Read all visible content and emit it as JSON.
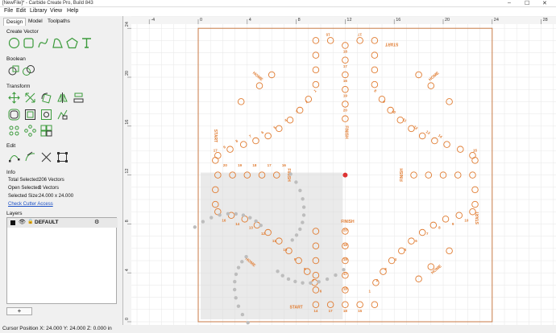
{
  "window": {
    "title": "[NewFile]* - Carbide Create Pro, Build 843",
    "controls": [
      "–",
      "☐",
      "✕"
    ]
  },
  "menu": [
    "File",
    "Edit",
    "Library",
    "View",
    "Help"
  ],
  "tabs": [
    "Design",
    "Model",
    "Toolpaths"
  ],
  "sections": {
    "create_vector": "Create Vector",
    "boolean": "Boolean",
    "transform": "Transform",
    "edit": "Edit",
    "info": "Info",
    "layers": "Layers"
  },
  "icons": {
    "create_vector": [
      "circle-icon",
      "rectangle-icon",
      "curve-icon",
      "polygon-icon",
      "pentagon-icon",
      "text-icon"
    ],
    "boolean": [
      "boolean-union-icon",
      "boolean-subtract-icon"
    ],
    "transform_row1": [
      "move-icon",
      "scale-icon",
      "rotate-icon",
      "mirror-icon",
      "align-icon"
    ],
    "transform_row2": [
      "offset-icon",
      "inset-icon",
      "outline-icon",
      "shape-icon"
    ],
    "transform_row3": [
      "array-icon",
      "circular-array-icon",
      "grid-array-icon"
    ],
    "edit": [
      "node-edit-icon",
      "bezier-icon",
      "cut-icon",
      "bounding-box-icon"
    ]
  },
  "info": {
    "total_selected": "Total Selected:",
    "total_selected_value": "206 Vectors",
    "open_selected": "Open Selected:",
    "open_selected_value": "0 Vectors",
    "selected_size": "Selected Size:",
    "selected_size_value": "24.000 x 24.000",
    "check_link": "Check Cutter Access"
  },
  "layers": {
    "name": "DEFAULT",
    "add_label": "+"
  },
  "status": "Cursor Position X: 24.000 Y: 24.000 Z: 0.000 in",
  "rulers": {
    "top": [
      "-4",
      "0",
      "4",
      "8",
      "12",
      "16",
      "20",
      "24",
      "28"
    ],
    "left": [
      "24",
      "20",
      "16",
      "12",
      "8",
      "4",
      "0"
    ]
  },
  "board": {
    "labels": {
      "start": "START",
      "home": "HOME",
      "finish": "FINISH"
    },
    "numbers": {
      "up_arm_left": [
        "15",
        "14",
        "13",
        "12",
        "11",
        "10",
        "9",
        "8",
        "7",
        "6",
        "5",
        "4",
        "3",
        "2"
      ],
      "up_arm_middle": [
        "18",
        "17",
        "16",
        "19",
        "20"
      ],
      "up_arm_right": [
        "17",
        "15",
        "14",
        "1",
        "2",
        "3",
        "4",
        "5",
        "6",
        "7",
        "8",
        "9",
        "10",
        "11",
        "12",
        "13",
        "14"
      ],
      "left_arm": [
        "1",
        "2",
        "3",
        "4",
        "5",
        "6",
        "7",
        "8",
        "9"
      ],
      "left_col": [
        "14",
        "15",
        "17",
        "18",
        "19",
        "20",
        "18",
        "15",
        "16"
      ],
      "right_arm": [
        "8",
        "9",
        "10",
        "11",
        "12",
        "13",
        "14"
      ],
      "right_col": [
        "15",
        "16",
        "17",
        "18",
        "19",
        "20"
      ],
      "bottom_left": [
        "16",
        "14",
        "13",
        "12",
        "11",
        "10",
        "9",
        "8",
        "7",
        "6"
      ],
      "bottom_mid": [
        "5",
        "4",
        "3",
        "2",
        "1",
        "14",
        "17",
        "18",
        "15"
      ],
      "bottom_right": [
        "20",
        "18",
        "19",
        "17",
        "18",
        "14",
        "12",
        "11",
        "10",
        "9",
        "8",
        "7",
        "6",
        "5",
        "4",
        "3",
        "2",
        "1"
      ]
    }
  },
  "colors": {
    "accent": "#e07b30",
    "board_border": "#c87a45",
    "grid": "#e6e6e6",
    "selection": "#d8d8d8"
  }
}
